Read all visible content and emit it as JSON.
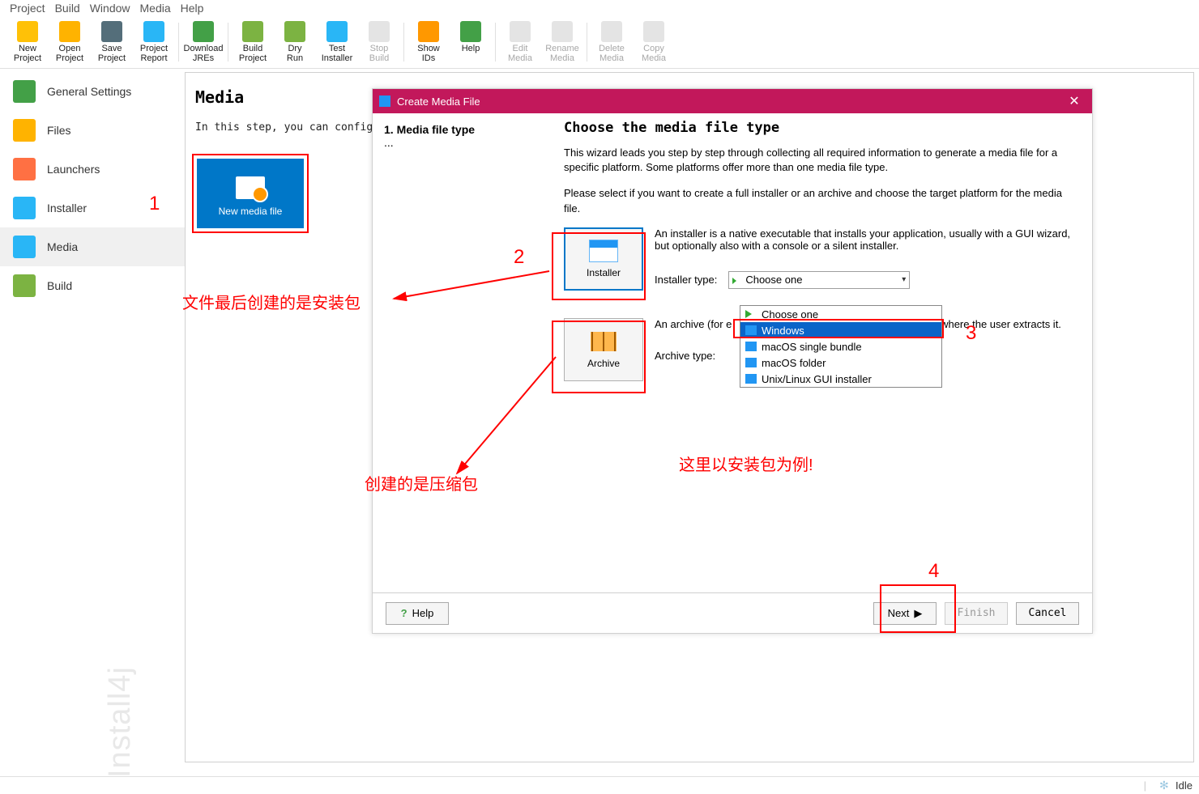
{
  "menu": [
    "Project",
    "Build",
    "Window",
    "Media",
    "Help"
  ],
  "toolbar": [
    {
      "id": "new-project",
      "label": "New\nProject",
      "color": "#ffc107"
    },
    {
      "id": "open-project",
      "label": "Open\nProject",
      "color": "#ffb300"
    },
    {
      "id": "save-project",
      "label": "Save\nProject",
      "color": "#546e7a"
    },
    {
      "id": "project-report",
      "label": "Project\nReport",
      "color": "#29b6f6"
    },
    {
      "sep": true
    },
    {
      "id": "download-jres",
      "label": "Download\nJREs",
      "color": "#43a047"
    },
    {
      "sep": true
    },
    {
      "id": "build-project",
      "label": "Build\nProject",
      "color": "#7cb342"
    },
    {
      "id": "dry-run",
      "label": "Dry\nRun",
      "color": "#7cb342"
    },
    {
      "id": "test-installer",
      "label": "Test\nInstaller",
      "color": "#29b6f6"
    },
    {
      "id": "stop-build",
      "label": "Stop\nBuild",
      "color": "#bdbdbd",
      "disabled": true
    },
    {
      "sep": true
    },
    {
      "id": "show-ids",
      "label": "Show\nIDs",
      "color": "#ff9800"
    },
    {
      "id": "help",
      "label": "Help\n ",
      "color": "#43a047"
    },
    {
      "sep": true
    },
    {
      "id": "edit-media",
      "label": "Edit\nMedia",
      "color": "#bdbdbd",
      "disabled": true
    },
    {
      "id": "rename-media",
      "label": "Rename\nMedia",
      "color": "#bdbdbd",
      "disabled": true
    },
    {
      "sep": true
    },
    {
      "id": "delete-media",
      "label": "Delete\nMedia",
      "color": "#bdbdbd",
      "disabled": true
    },
    {
      "id": "copy-media",
      "label": "Copy\nMedia",
      "color": "#bdbdbd",
      "disabled": true
    }
  ],
  "sidebar": {
    "items": [
      {
        "id": "general-settings",
        "label": "General Settings"
      },
      {
        "id": "files",
        "label": "Files"
      },
      {
        "id": "launchers",
        "label": "Launchers"
      },
      {
        "id": "installer",
        "label": "Installer"
      },
      {
        "id": "media",
        "label": "Media"
      },
      {
        "id": "build",
        "label": "Build"
      }
    ],
    "selected": "media"
  },
  "content": {
    "title": "Media",
    "desc": "In this step, you can configure the list.",
    "tile_label": "New media file"
  },
  "dialog": {
    "title": "Create Media File",
    "step": "1. Media file type",
    "ell": "...",
    "heading": "Choose the media file type",
    "p1": "This wizard leads you step by step through collecting all required information to generate a media file for a specific platform. Some platforms offer more than one media file type.",
    "p2": "Please select if you want to create a full installer or an archive and choose the target platform for the media file.",
    "installer_desc": "An installer is a native executable that installs your application, usually with a GUI wizard, but optionally also with a console or a silent installer.",
    "installer_label": "Installer",
    "installer_type_label": "Installer type:",
    "combo_value": "Choose one",
    "archive_desc_pre": "An archive (for e",
    "archive_desc_post": "to where the user extracts it.",
    "archive_label": "Archive",
    "archive_type_label": "Archive type:",
    "options": [
      "Choose one",
      "Windows",
      "macOS single bundle",
      "macOS folder",
      "Unix/Linux GUI installer"
    ],
    "highlighted": "Windows",
    "buttons": {
      "help": "Help",
      "next": "Next",
      "finish": "Finish",
      "cancel": "Cancel"
    }
  },
  "annotations": {
    "n1": "1",
    "n2": "2",
    "n3": "3",
    "n4": "4",
    "t1": "文件最后创建的是安装包",
    "t2": "创建的是压缩包",
    "t3": "这里以安装包为例!"
  },
  "status": {
    "idle": "Idle"
  },
  "watermark": "Install4j"
}
